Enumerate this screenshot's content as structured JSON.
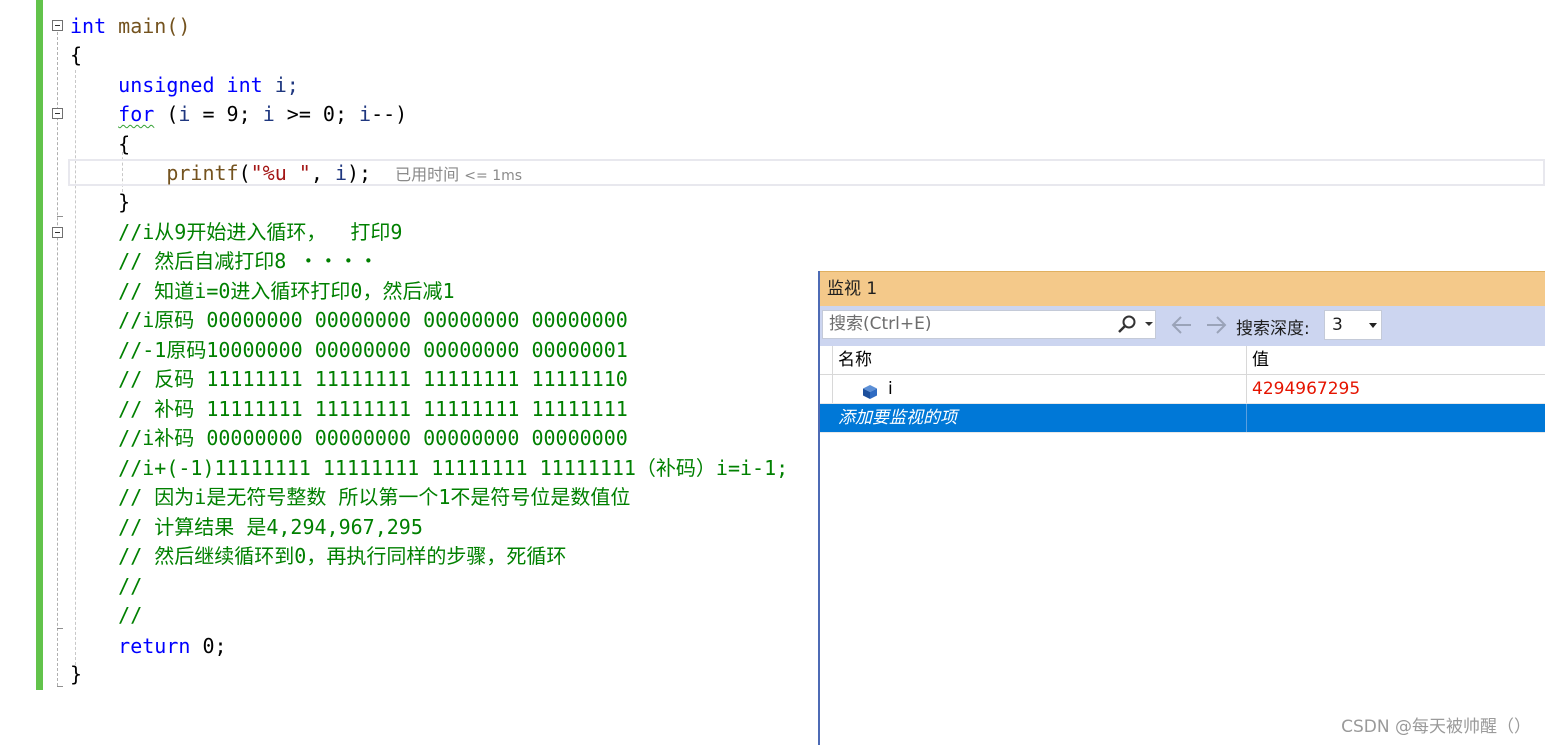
{
  "editor": {
    "lines": {
      "l1": {
        "kw": "int",
        "fn": " main()"
      },
      "l2": "{",
      "l3": {
        "kw1": "unsigned",
        "kw2": "int",
        "id": " i;"
      },
      "l4": {
        "kw": "for",
        "open": " (",
        "id1": "i",
        "rest1": " = 9; ",
        "id2": "i",
        "rest2": " >= 0; ",
        "id3": "i",
        "rest3": "--)"
      },
      "l5": "{",
      "l6": {
        "fn": "printf",
        "open": "(",
        "str": "\"%u \"",
        "mid": ", ",
        "id": "i",
        "close": ");"
      },
      "l7": "}",
      "l8": "//i从9开始进入循环，  打印9",
      "l9": "// 然后自减打印8 ・・・・",
      "l10": "// 知道i=0进入循环打印0，然后减1",
      "l11": "//i原码 00000000 00000000 00000000 00000000",
      "l12": "//-1原码10000000 00000000 00000000 00000001",
      "l13": "// 反码 11111111 11111111 11111111 11111110",
      "l14": "// 补码 11111111 11111111 11111111 11111111",
      "l15": "//i补码 00000000 00000000 00000000 00000000",
      "l16": "//i+(-1)11111111 11111111 11111111 11111111（补码）i=i-1;",
      "l17": "// 因为i是无符号整数 所以第一个1不是符号位是数值位",
      "l18": "// 计算结果 是4,294,967,295",
      "l19": "// 然后继续循环到0，再执行同样的步骤，死循环",
      "l20": "//",
      "l21": "//",
      "l22": {
        "kw": "return",
        "rest": " 0;"
      },
      "l23": "}"
    },
    "perf_tip": {
      "label": "已用时间",
      "value": "<= 1ms"
    }
  },
  "watch": {
    "title": "监视 1",
    "search_placeholder": "搜索(Ctrl+E)",
    "depth_label": "搜索深度:",
    "depth_value": "3",
    "columns": {
      "name": "名称",
      "value": "值"
    },
    "rows": [
      {
        "name": "i",
        "value": "4294967295"
      }
    ],
    "add_item_label": "添加要监视的项"
  },
  "watermark": "CSDN @每天被帅醒（）",
  "colors": {
    "keyword": "#0000ff",
    "comment": "#008000",
    "string": "#a31515",
    "changed_value": "#e51400",
    "selection": "#0078d7",
    "watch_title": "#f4c98a",
    "watch_toolbar": "#ccd5f0",
    "change_bar": "#62c34b"
  }
}
